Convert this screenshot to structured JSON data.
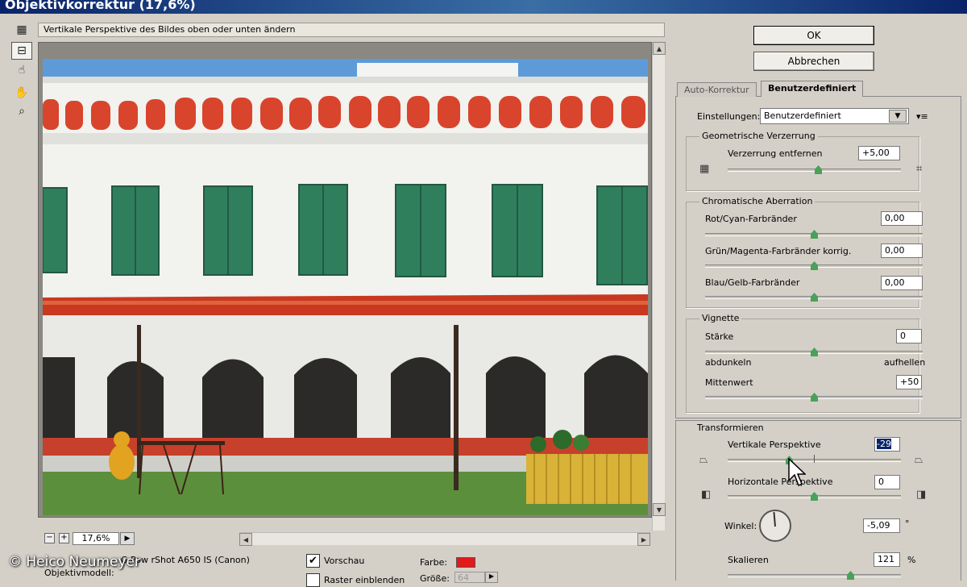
{
  "window": {
    "title": "Objektivkorrektur (17,6%)"
  },
  "tools": [
    {
      "name": "grid-tool-icon",
      "glyph": "▦"
    },
    {
      "name": "straighten-tool-icon",
      "glyph": "⊟"
    },
    {
      "name": "move-grid-tool-icon",
      "glyph": "☝"
    },
    {
      "name": "hand-tool-icon",
      "glyph": "✋"
    },
    {
      "name": "zoom-tool-icon",
      "glyph": "🔍"
    }
  ],
  "hint": "Vertikale Perspektive des Bildes oben oder unten ändern",
  "zoom": {
    "minus": "−",
    "plus": "+",
    "value": "17,6%",
    "arrow": "▶"
  },
  "bottom": {
    "camera_text": "G Pow  rShot A650 IS (Canon)",
    "lens_text": "Objektivmodell:",
    "preview_label": "Vorschau",
    "preview_checked": "✔",
    "grid_label": "Raster einblenden",
    "color_label": "Farbe:",
    "color_value": "#e31a1a",
    "size_label": "Größe:",
    "size_value": "64",
    "size_arrow": "▶",
    "watermark": "© Heico Neumeyer"
  },
  "buttons": {
    "ok": "OK",
    "cancel": "Abbrechen"
  },
  "tabs": {
    "auto": "Auto-Korrektur",
    "custom": "Benutzerdefiniert"
  },
  "settings": {
    "label": "Einstellungen:",
    "value": "Benutzerdefiniert",
    "dropdown": "▼",
    "menu": "▾≡"
  },
  "geometric": {
    "title": "Geometrische Verzerrung",
    "label": "Verzerrung entfernen",
    "value": "+5,00",
    "slider": 0.55,
    "left_icon": "barrel-icon",
    "right_icon": "pincushion-icon"
  },
  "chromatic": {
    "title": "Chromatische Aberration",
    "rows": [
      {
        "label": "Rot/Cyan-Farbränder",
        "value": "0,00"
      },
      {
        "label": "Grün/Magenta-Farbränder korrig.",
        "value": "0,00"
      },
      {
        "label": "Blau/Gelb-Farbränder",
        "value": "0,00"
      }
    ]
  },
  "vignette": {
    "title": "Vignette",
    "amount_label": "Stärke",
    "amount_value": "0",
    "darken": "abdunkeln",
    "lighten": "aufhellen",
    "midpoint_label": "Mittenwert",
    "midpoint_value": "+50"
  },
  "transform": {
    "title": "Transformieren",
    "vp_label": "Vertikale Perspektive",
    "vp_value": "-29",
    "vp_slider": 0.36,
    "hp_label": "Horizontale Perspektive",
    "hp_value": "0",
    "angle_label": "Winkel:",
    "angle_value": "-5,09",
    "angle_unit": "°",
    "scale_label": "Skalieren",
    "scale_value": "121",
    "scale_unit": "%"
  }
}
